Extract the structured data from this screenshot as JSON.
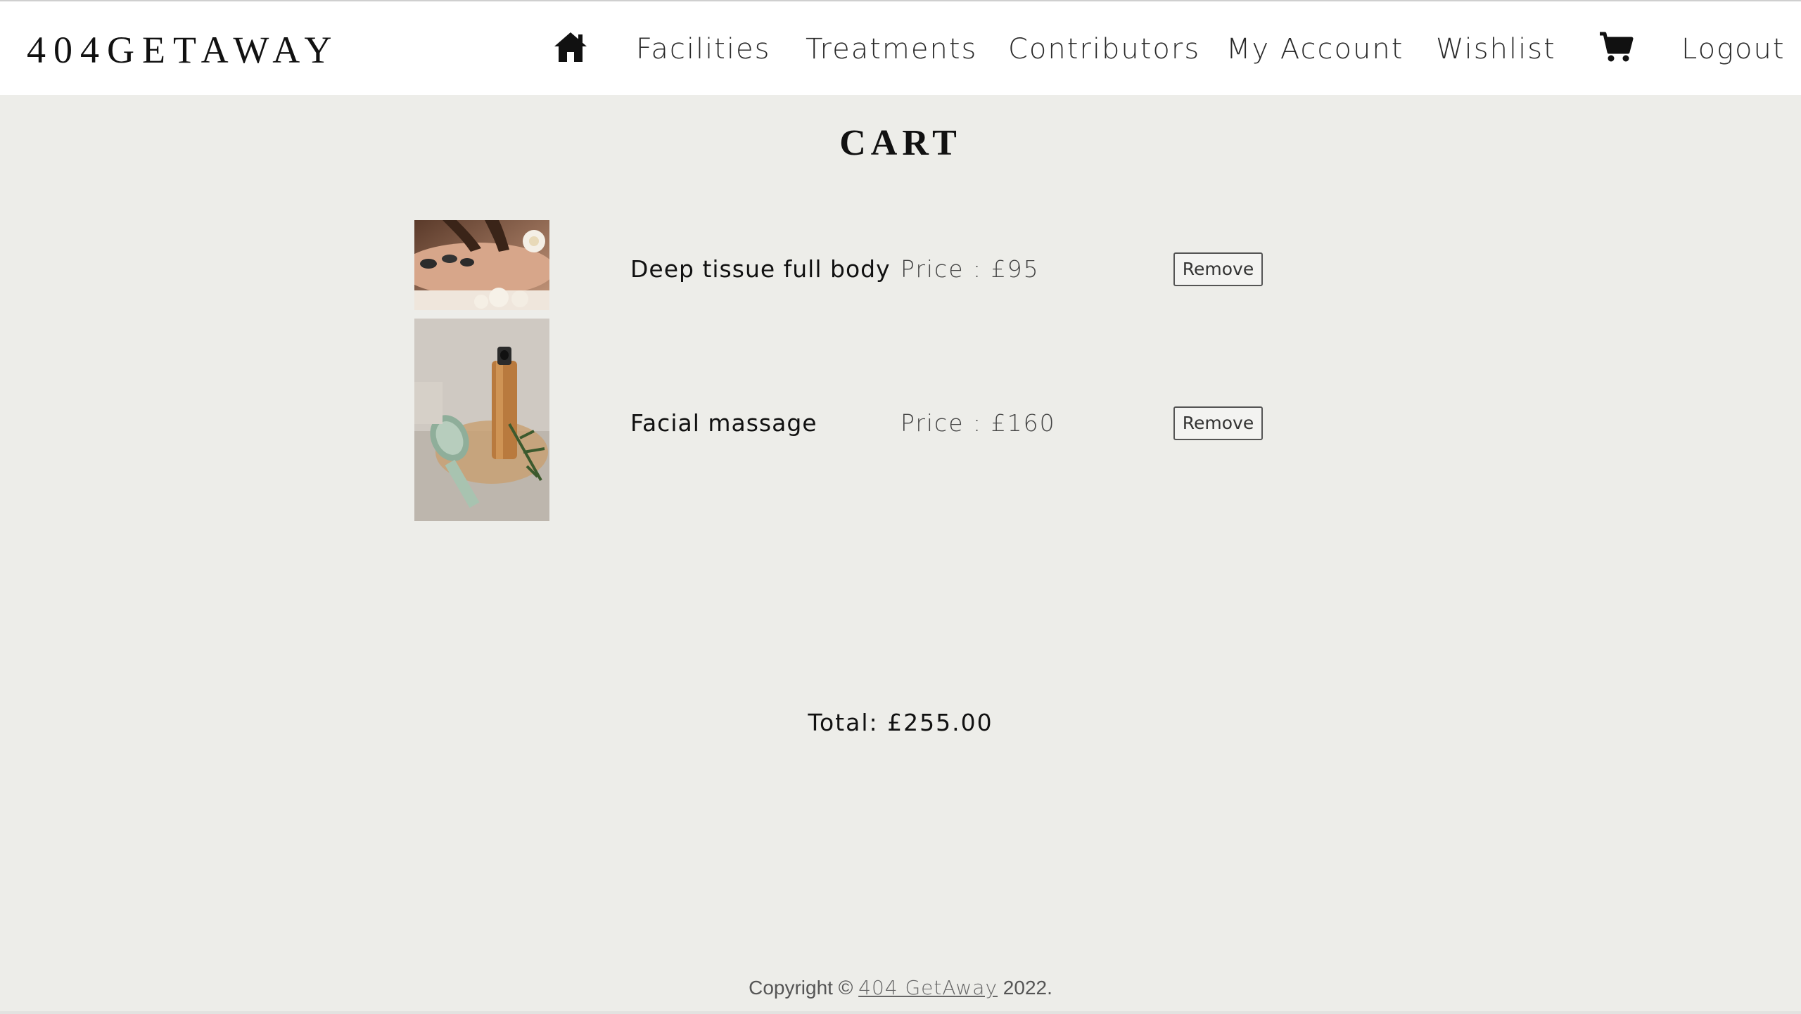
{
  "nav": {
    "brand": "404GETAWAY",
    "home_icon": "home-icon",
    "links": [
      "Facilities",
      "Treatments",
      "Contributors",
      "My Account",
      "Wishlist"
    ],
    "cart_icon": "cart-icon",
    "logout": "Logout"
  },
  "page": {
    "title": "CART"
  },
  "cart": {
    "items": [
      {
        "name": "Deep tissue full body",
        "price": "Price : £95",
        "remove_label": "Remove",
        "image": "hot-stone-massage-photo"
      },
      {
        "name": "Facial massage",
        "price": "Price : £160",
        "remove_label": "Remove",
        "image": "jade-roller-facial-photo"
      }
    ],
    "total": "Total: £255.00"
  },
  "footer": {
    "prefix": "Copyright © ",
    "link": "404 GetAway",
    "suffix": " 2022."
  }
}
